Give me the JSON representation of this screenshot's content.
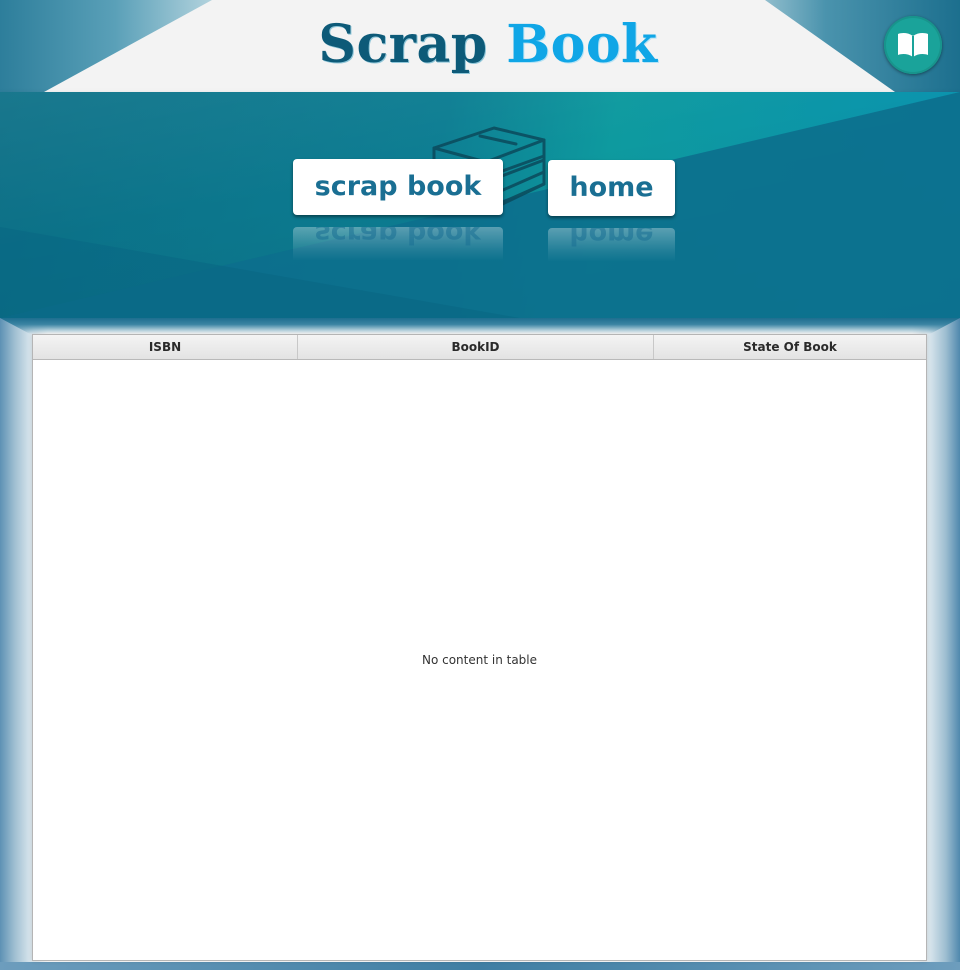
{
  "header": {
    "title_word1": "Scrap",
    "title_word2": "Book",
    "logo_icon": "open-book-icon",
    "colors": {
      "title_word1": "#0d5a78",
      "title_word2": "#10a6e6",
      "logo_bg": "#1aa39a"
    }
  },
  "banner": {
    "background_icon": "books-stack-icon",
    "buttons": {
      "scrap_book": "scrap book",
      "home": "home"
    },
    "colors": {
      "banner": "#0c7d92",
      "button_text": "#1a6f93"
    }
  },
  "table": {
    "columns": [
      "ISBN",
      "BookID",
      "State Of Book"
    ],
    "rows": [],
    "placeholder": "No content in table"
  }
}
